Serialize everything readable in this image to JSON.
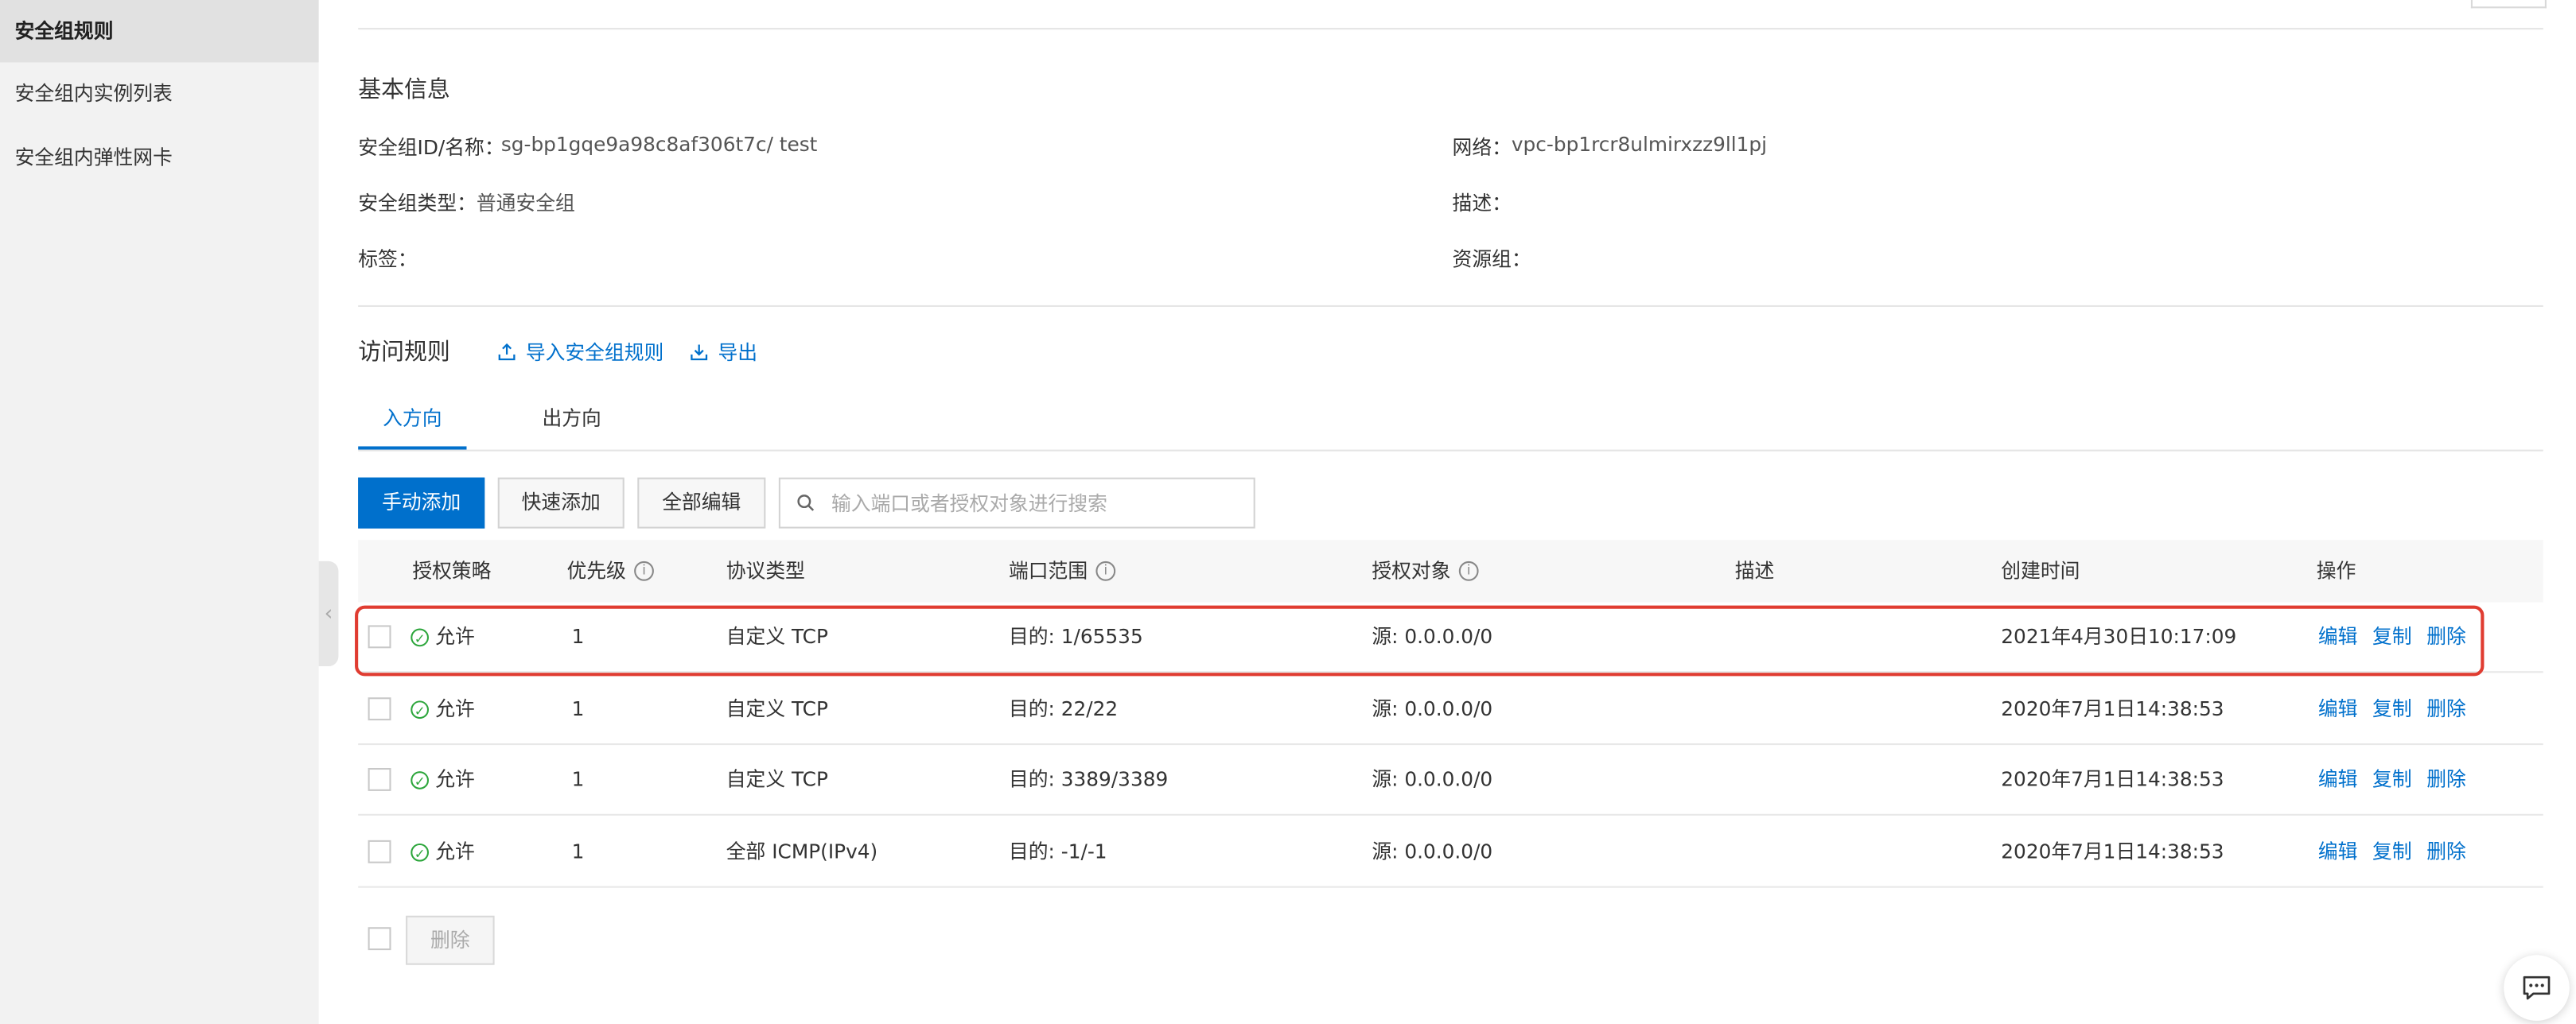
{
  "sidebar": {
    "items": [
      {
        "label": "安全组规则",
        "active": true
      },
      {
        "label": "安全组内实例列表",
        "active": false
      },
      {
        "label": "安全组内弹性网卡",
        "active": false
      }
    ]
  },
  "basic_info": {
    "title": "基本信息",
    "id_label": "安全组ID/名称：",
    "id_value": "sg-bp1gqe9a98c8af306t7c/ test",
    "type_label": "安全组类型：",
    "type_value": "普通安全组",
    "tags_label": "标签：",
    "network_label": "网络：",
    "network_value": "vpc-bp1rcr8ulmirxzz9ll1pj",
    "desc_label": "描述：",
    "resource_group_label": "资源组："
  },
  "rules": {
    "title": "访问规则",
    "import_label": "导入安全组规则",
    "export_label": "导出"
  },
  "tabs": [
    {
      "label": "入方向",
      "active": true
    },
    {
      "label": "出方向",
      "active": false
    }
  ],
  "toolbar": {
    "manual_add": "手动添加",
    "quick_add": "快速添加",
    "edit_all": "全部编辑",
    "search_placeholder": "输入端口或者授权对象进行搜索"
  },
  "table": {
    "headers": {
      "policy": "授权策略",
      "priority": "优先级",
      "protocol": "协议类型",
      "port": "端口范围",
      "auth": "授权对象",
      "desc": "描述",
      "created": "创建时间",
      "ops": "操作"
    },
    "rows": [
      {
        "policy": "允许",
        "priority": "1",
        "protocol": "自定义 TCP",
        "port": "目的: 1/65535",
        "auth": "源: 0.0.0.0/0",
        "desc": "",
        "created": "2021年4月30日10:17:09"
      },
      {
        "policy": "允许",
        "priority": "1",
        "protocol": "自定义 TCP",
        "port": "目的: 22/22",
        "auth": "源: 0.0.0.0/0",
        "desc": "",
        "created": "2020年7月1日14:38:53"
      },
      {
        "policy": "允许",
        "priority": "1",
        "protocol": "自定义 TCP",
        "port": "目的: 3389/3389",
        "auth": "源: 0.0.0.0/0",
        "desc": "",
        "created": "2020年7月1日14:38:53"
      },
      {
        "policy": "允许",
        "priority": "1",
        "protocol": "全部 ICMP(IPv4)",
        "port": "目的: -1/-1",
        "auth": "源: 0.0.0.0/0",
        "desc": "",
        "created": "2020年7月1日14:38:53"
      }
    ],
    "ops": {
      "edit": "编辑",
      "copy": "复制",
      "delete": "删除"
    }
  },
  "footer": {
    "delete_label": "删除"
  },
  "colors": {
    "accent": "#0070cc",
    "highlight_border": "#e03c31",
    "allow_green": "#2da63c"
  }
}
